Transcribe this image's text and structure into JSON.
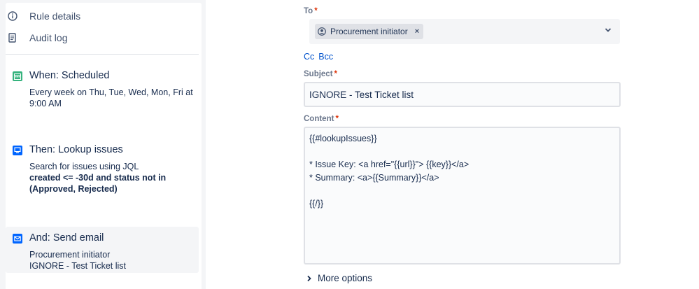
{
  "sidebar": {
    "nav": [
      {
        "label": "Rule details",
        "icon": "info-icon"
      },
      {
        "label": "Audit log",
        "icon": "document-icon"
      }
    ],
    "steps": [
      {
        "title": "When: Scheduled",
        "icon": "calendar-icon",
        "icon_color": "#36b37e",
        "desc": "Every week on Thu, Tue, Wed, Mon, Fri at 9:00 AM"
      },
      {
        "title": "Then: Lookup issues",
        "icon": "lookup-issues-icon",
        "icon_color": "#0065ff",
        "desc": "Search for issues using JQL",
        "desc_bold": "created <= -30d and status not in (Approved, Rejected)"
      },
      {
        "title": "And: Send email",
        "icon": "email-icon",
        "icon_color": "#0065ff",
        "desc_line1": "Procurement initiator",
        "desc_line2": "IGNORE - Test Ticket list",
        "selected": true
      }
    ]
  },
  "form": {
    "to": {
      "label": "To",
      "required_mark": "*",
      "chips": [
        {
          "label": "Procurement initiator",
          "remove": "×"
        }
      ]
    },
    "cc_label": "Cc",
    "bcc_label": "Bcc",
    "subject": {
      "label": "Subject",
      "required_mark": "*",
      "value": "IGNORE - Test Ticket list"
    },
    "content": {
      "label": "Content",
      "required_mark": "*",
      "value": "{{#lookupIssues}}\n\n* Issue Key: <a href=\"{{url}}\"> {{key}}</a>\n* Summary: <a>{{Summary}}</a>\n\n{{/}}"
    },
    "more_options_label": "More options"
  },
  "colors": {
    "link": "#0052cc",
    "required": "#de350b",
    "sidebar_bg": "#f4f5f7"
  }
}
